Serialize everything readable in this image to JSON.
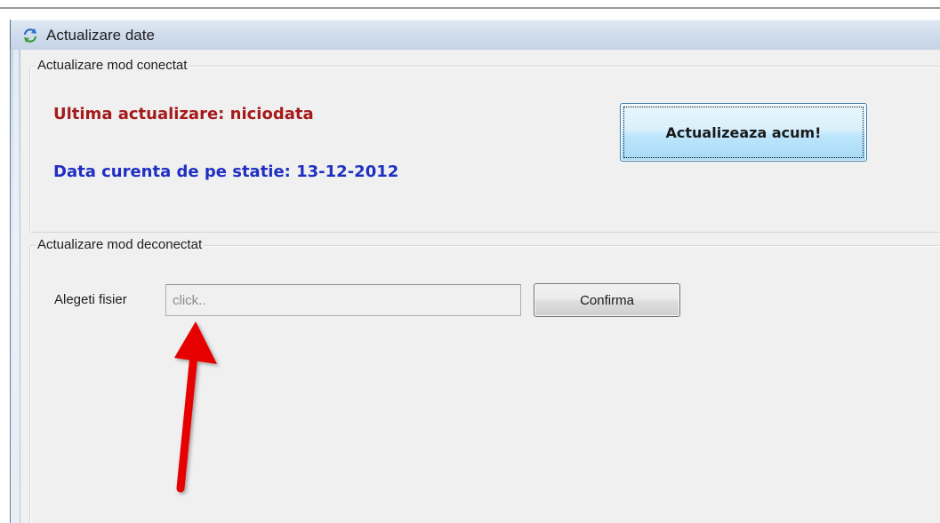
{
  "window": {
    "title": "Actualizare date",
    "icon": "refresh-icon"
  },
  "connected": {
    "group_label": "Actualizare mod conectat",
    "last_update": "Ultima actualizare: niciodata",
    "current_date": "Data curenta de pe statie: 13-12-2012",
    "update_button_label": "Actualizeaza acum!",
    "colors": {
      "last_update": "#a51a1a",
      "current_date": "#1f2fc2"
    }
  },
  "disconnected": {
    "group_label": "Actualizare mod deconectat",
    "file_label": "Alegeti fisier",
    "file_value": "click..",
    "confirm_button_label": "Confirma"
  },
  "annotation": {
    "arrow_color": "#e60000",
    "arrow_icon": "red-arrow-pointer"
  }
}
